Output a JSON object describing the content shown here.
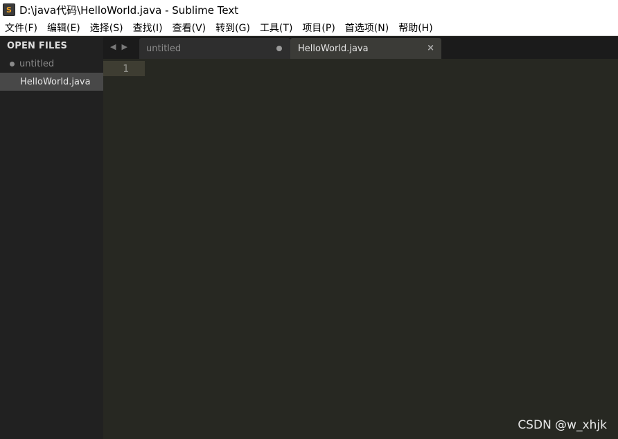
{
  "window": {
    "title": "D:\\java代码\\HelloWorld.java - Sublime Text",
    "icon": "sublime-text-app-icon",
    "icon_glyph": "S"
  },
  "menu": [
    {
      "label": "文件(F)"
    },
    {
      "label": "编辑(E)"
    },
    {
      "label": "选择(S)"
    },
    {
      "label": "查找(I)"
    },
    {
      "label": "查看(V)"
    },
    {
      "label": "转到(G)"
    },
    {
      "label": "工具(T)"
    },
    {
      "label": "项目(P)"
    },
    {
      "label": "首选项(N)"
    },
    {
      "label": "帮助(H)"
    }
  ],
  "sidebar": {
    "heading": "OPEN FILES",
    "files": [
      {
        "name": "untitled",
        "modified": true
      },
      {
        "name": "HelloWorld.java",
        "active": true
      }
    ]
  },
  "tabs": {
    "nav_prev": "◀",
    "nav_next": "▶",
    "items": [
      {
        "label": "untitled",
        "state": "modified"
      },
      {
        "label": "HelloWorld.java",
        "state": "active",
        "close": "×"
      }
    ]
  },
  "editor": {
    "line_numbers": [
      "1"
    ]
  },
  "watermark": "CSDN @w_xhjk",
  "colors": {
    "editor_bg": "#272822",
    "sidebar_bg": "#212121",
    "tabbar_bg": "#1b1b1b",
    "active_line": "#3e3d32"
  }
}
